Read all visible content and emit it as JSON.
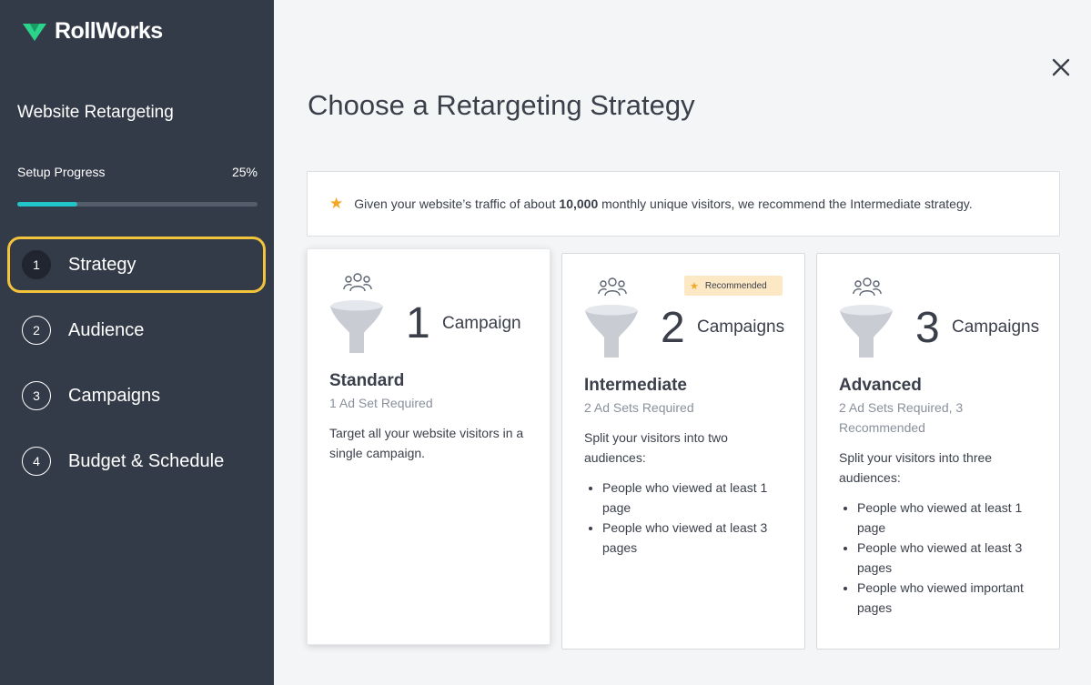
{
  "brand": {
    "name": "RollWorks",
    "accent": "#2bd48a"
  },
  "sidebar": {
    "title": "Website Retargeting",
    "progress": {
      "label": "Setup Progress",
      "value_text": "25%",
      "value": 0.25,
      "color": "#21c4c9"
    },
    "steps": [
      {
        "num": "1",
        "label": "Strategy",
        "active": true
      },
      {
        "num": "2",
        "label": "Audience"
      },
      {
        "num": "3",
        "label": "Campaigns"
      },
      {
        "num": "4",
        "label": "Budget & Schedule"
      }
    ]
  },
  "main": {
    "title": "Choose a Retargeting Strategy",
    "close_icon": "close-icon",
    "banner": {
      "icon": "star-icon",
      "text_before": "Given your website’s traffic of about ",
      "highlight": "10,000",
      "text_after": " monthly unique visitors, we recommend the Intermediate strategy."
    },
    "cards": [
      {
        "count": "1",
        "campaign_word": "Campaign",
        "name": "Standard",
        "requirement": "1 Ad Set Required",
        "description": "Target all your website visitors in a single campaign.",
        "bullets": []
      },
      {
        "count": "2",
        "campaign_word": "Campaigns",
        "name": "Intermediate",
        "badge": "Recommended",
        "requirement": "2 Ad Sets Required",
        "description": "Split your visitors into two audiences:",
        "bullets": [
          "People who viewed at least 1 page",
          "People who viewed at least 3 pages"
        ]
      },
      {
        "count": "3",
        "campaign_word": "Campaigns",
        "name": "Advanced",
        "requirement": "2 Ad Sets Required, 3 Recommended",
        "description": "Split your visitors into three audiences:",
        "bullets": [
          "People who viewed at least 1 page",
          "People who viewed at least 3 pages",
          "People who viewed important pages"
        ]
      }
    ]
  }
}
